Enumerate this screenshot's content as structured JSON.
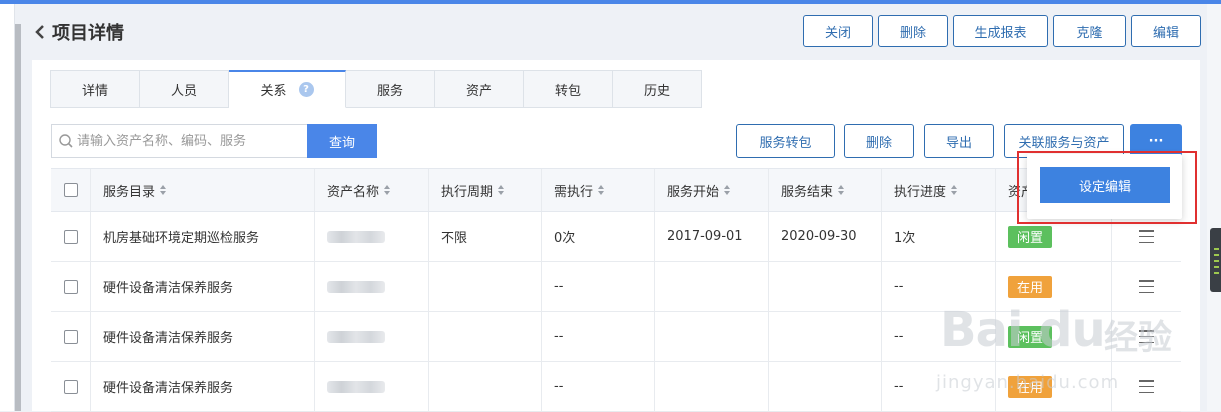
{
  "header": {
    "title": "项目详情"
  },
  "header_actions": [
    "关闭",
    "删除",
    "生成报表",
    "克隆",
    "编辑"
  ],
  "tabs": [
    {
      "label": "详情"
    },
    {
      "label": "人员"
    },
    {
      "label": "关系",
      "active": true,
      "help_icon": "question-icon"
    },
    {
      "label": "服务"
    },
    {
      "label": "资产"
    },
    {
      "label": "转包"
    },
    {
      "label": "历史"
    }
  ],
  "search": {
    "placeholder": "请输入资产名称、编码、服务",
    "value": "",
    "button": "查询"
  },
  "toolbar": [
    "服务转包",
    "删除",
    "导出",
    "关联服务与资产"
  ],
  "more": {
    "label": "···",
    "menu_item": "设定编辑"
  },
  "table": {
    "columns": [
      "服务目录",
      "资产名称",
      "执行周期",
      "需执行",
      "服务开始",
      "服务结束",
      "执行进度",
      "资产"
    ],
    "rows": [
      {
        "service": "机房基础环境定期巡检服务",
        "asset": "",
        "cycle": "不限",
        "need": "0次",
        "start": "2017-09-01",
        "end": "2020-09-30",
        "progress": "1次",
        "status": "闲置",
        "status_color": "#5cc05e"
      },
      {
        "service": "硬件设备清洁保养服务",
        "asset": "",
        "cycle": "",
        "need": "--",
        "start": "",
        "end": "",
        "progress": "--",
        "status": "在用",
        "status_color": "#f0a23c"
      },
      {
        "service": "硬件设备清洁保养服务",
        "asset": "",
        "cycle": "",
        "need": "--",
        "start": "",
        "end": "",
        "progress": "--",
        "status": "闲置",
        "status_color": "#5cc05e"
      },
      {
        "service": "硬件设备清洁保养服务",
        "asset": "",
        "cycle": "",
        "need": "--",
        "start": "",
        "end": "",
        "progress": "--",
        "status": "在用",
        "status_color": "#f0a23c"
      }
    ]
  },
  "watermark": {
    "logo": "Bai du",
    "brand": "经验",
    "url": "jingyan.baidu.com"
  }
}
